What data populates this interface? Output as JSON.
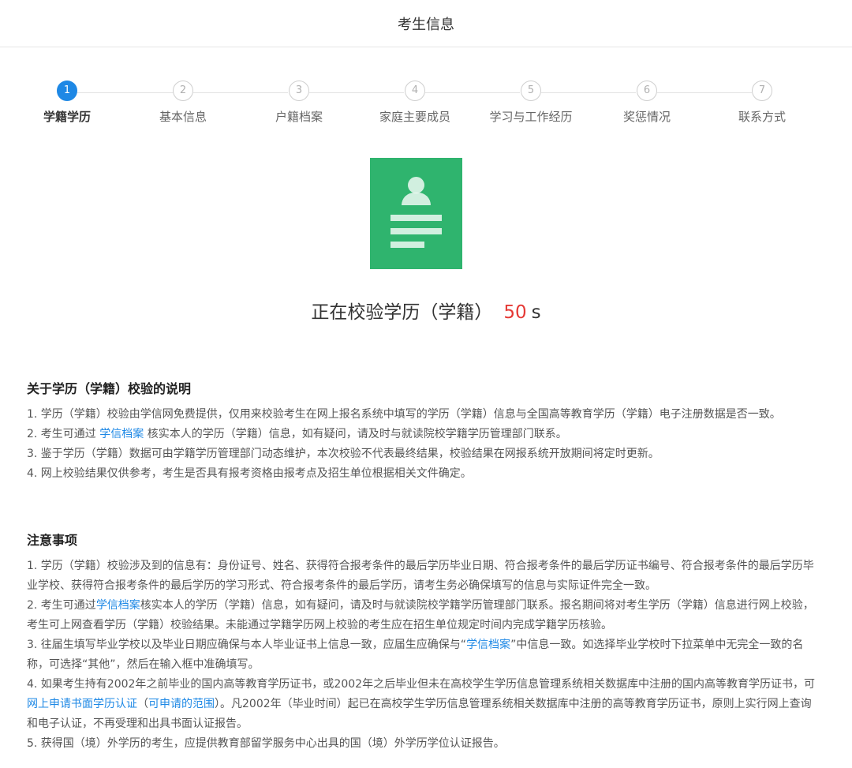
{
  "header": {
    "title": "考生信息"
  },
  "steps": [
    {
      "number": "1",
      "label": "学籍学历"
    },
    {
      "number": "2",
      "label": "基本信息"
    },
    {
      "number": "3",
      "label": "户籍档案"
    },
    {
      "number": "4",
      "label": "家庭主要成员"
    },
    {
      "number": "5",
      "label": "学习与工作经历"
    },
    {
      "number": "6",
      "label": "奖惩情况"
    },
    {
      "number": "7",
      "label": "联系方式"
    }
  ],
  "active_step": 1,
  "verify": {
    "icon": "document-person-icon",
    "text": "正在校验学历（学籍）",
    "countdown": "50",
    "unit": "s",
    "countdown_color": "#e53935",
    "icon_color": "#2fb46e"
  },
  "about": {
    "title": "关于学历（学籍）校验的说明",
    "p1": "1. 学历（学籍）校验由学信网免费提供，仅用来校验考生在网上报名系统中填写的学历（学籍）信息与全国高等教育学历（学籍）电子注册数据是否一致。",
    "p2_a": "2. 考生可通过 ",
    "p2_link": "学信档案",
    "p2_b": " 核实本人的学历（学籍）信息，如有疑问，请及时与就读院校学籍学历管理部门联系。",
    "p3": "3. 鉴于学历（学籍）数据可由学籍学历管理部门动态维护，本次校验不代表最终结果，校验结果在网报系统开放期间将定时更新。",
    "p4": "4. 网上校验结果仅供参考，考生是否具有报考资格由报考点及招生单位根据相关文件确定。"
  },
  "notes": {
    "title": "注意事项",
    "p1": "1. 学历（学籍）校验涉及到的信息有：身份证号、姓名、获得符合报考条件的最后学历毕业日期、符合报考条件的最后学历证书编号、符合报考条件的最后学历毕业学校、获得符合报考条件的最后学历的学习形式、符合报考条件的最后学历，请考生务必确保填写的信息与实际证件完全一致。",
    "p2_a": "2. 考生可通过",
    "p2_link": "学信档案",
    "p2_b": "核实本人的学历（学籍）信息，如有疑问，请及时与就读院校学籍学历管理部门联系。报名期间将对考生学历（学籍）信息进行网上校验，考生可上网查看学历（学籍）校验结果。未能通过学籍学历网上校验的考生应在招生单位规定时间内完成学籍学历核验。",
    "p3_a": "3. 往届生填写毕业学校以及毕业日期应确保与本人毕业证书上信息一致，应届生应确保与“",
    "p3_link": "学信档案",
    "p3_b": "”中信息一致。如选择毕业学校时下拉菜单中无完全一致的名称，可选择“其他”，然后在输入框中准确填写。",
    "p4_a": "4. 如果考生持有2002年之前毕业的国内高等教育学历证书，或2002年之后毕业但未在高校学生学历信息管理系统相关数据库中注册的国内高等教育学历证书，可",
    "p4_link1": "网上申请书面学历认证",
    "p4_mid": "（",
    "p4_link2": "可申请的范围",
    "p4_b": "）。凡2002年（毕业时间）起已在高校学生学历信息管理系统相关数据库中注册的高等教育学历证书，原则上实行网上查询和电子认证，不再受理和出具书面认证报告。",
    "p5": "5. 获得国（境）外学历的考生，应提供教育部留学服务中心出具的国（境）外学历学位认证报告。"
  }
}
